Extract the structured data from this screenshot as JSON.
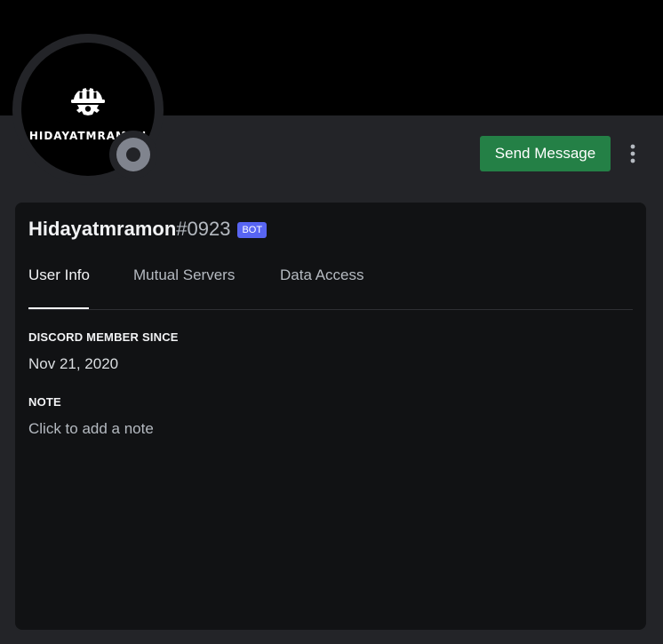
{
  "colors": {
    "banner": "#000000",
    "background": "#232428",
    "card": "#111214",
    "send_button": "#248046",
    "bot_tag": "#5865f2",
    "status_offline": "#80848e"
  },
  "avatar": {
    "logo_icon": "hardhat-gear-icon",
    "text": "HIDAYATMRAMON"
  },
  "status": {
    "icon": "offline-status-icon"
  },
  "actions": {
    "send_message_label": "Send Message",
    "more_icon": "vertical-ellipsis-icon"
  },
  "profile": {
    "username": "Hidayatmramon",
    "discriminator": "#0923",
    "bot_tag": "BOT"
  },
  "tabs": [
    {
      "label": "User Info",
      "active": true
    },
    {
      "label": "Mutual Servers",
      "active": false
    },
    {
      "label": "Data Access",
      "active": false
    }
  ],
  "user_info": {
    "member_since_title": "DISCORD MEMBER SINCE",
    "member_since_value": "Nov 21, 2020",
    "note_title": "NOTE",
    "note_placeholder": "Click to add a note"
  }
}
